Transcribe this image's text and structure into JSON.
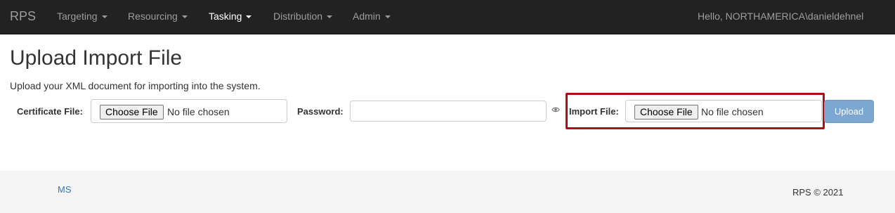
{
  "navbar": {
    "brand": "RPS",
    "items": [
      {
        "label": "Targeting"
      },
      {
        "label": "Resourcing"
      },
      {
        "label": "Tasking"
      },
      {
        "label": "Distribution"
      },
      {
        "label": "Admin"
      }
    ],
    "greeting": "Hello, NORTHAMERICA\\danieldehnel"
  },
  "page": {
    "title": "Upload Import File",
    "description": "Upload your XML document for importing into the system."
  },
  "form": {
    "certificate_label": "Certificate File:",
    "password_label": "Password:",
    "password_value": "",
    "import_label": "Import File:",
    "choose_file_label": "Choose File",
    "no_file_text": "No file chosen",
    "upload_label": "Upload"
  },
  "footer": {
    "link": "MS",
    "copyright": "RPS © 2021"
  },
  "colors": {
    "navbar_bg": "#222222",
    "highlight_border": "#b10e13",
    "upload_button": "#7ba7d1",
    "link": "#337ab7"
  },
  "icons": {
    "password_toggle": "eye-icon",
    "dropdown": "caret-down-icon"
  }
}
